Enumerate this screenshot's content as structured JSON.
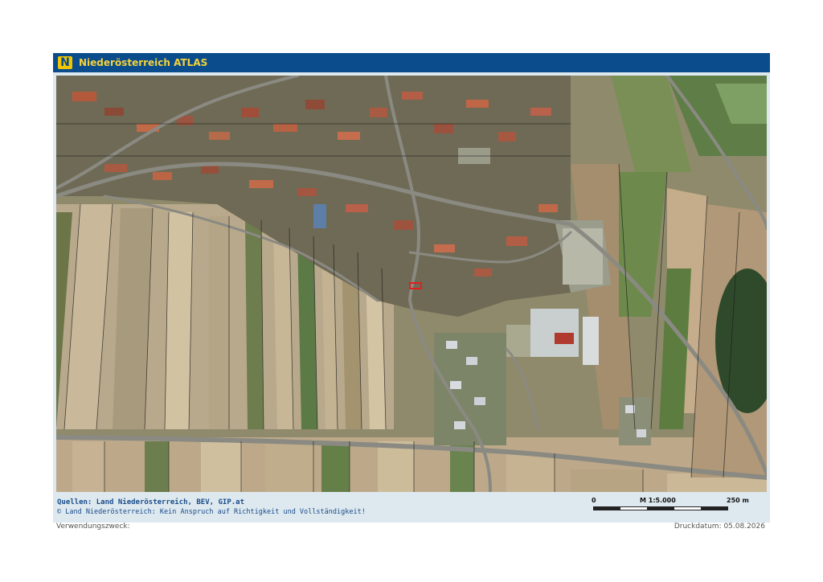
{
  "header": {
    "logo_letter": "N",
    "title": "Niederösterreich ATLAS"
  },
  "footer": {
    "sources": "Quellen: Land Niederösterreich, BEV, GIP.at",
    "copyright": "© Land Niederösterreich: Kein Anspruch auf Richtigkeit und Vollständigkeit!",
    "scale": {
      "start": "0",
      "ratio": "M 1:5.000",
      "end": "250 m"
    }
  },
  "purpose_label": "Verwendungszweck:",
  "print_date": "Druckdatum: 05.08.2026",
  "colors": {
    "header_bg": "#0a4c8c",
    "title": "#f4d23c",
    "logo_bg": "#f2c500",
    "footer_text": "#1a4d8a",
    "parcel_highlight": "#e02020"
  },
  "map": {
    "type": "aerial-cadastral",
    "highlighted_parcel_color": "red"
  }
}
